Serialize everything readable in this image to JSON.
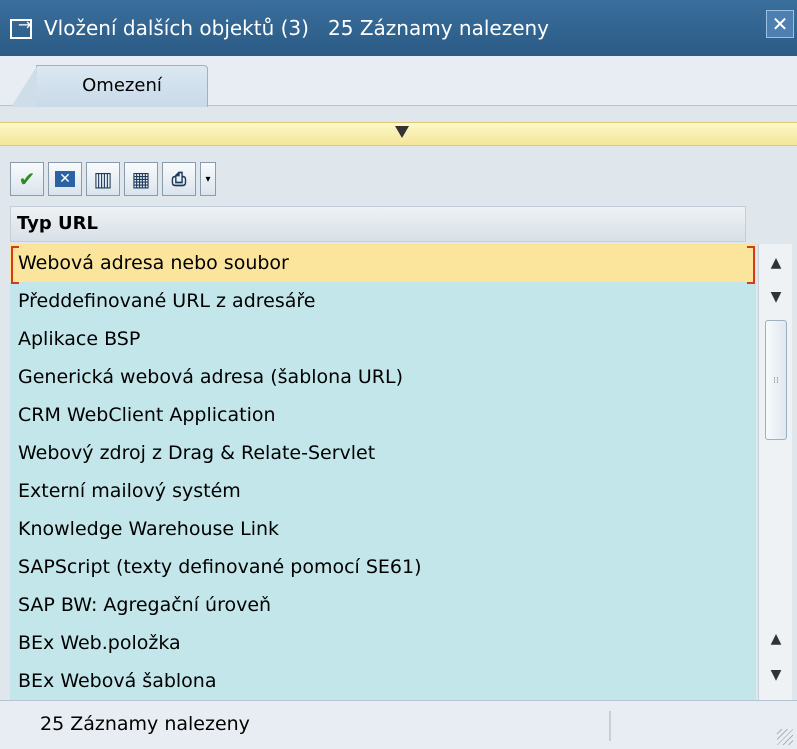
{
  "window": {
    "title": "Vložení dalších objektů (3)   25 Záznamy nalezeny",
    "close_glyph": "✕"
  },
  "tabs": [
    {
      "label": "Omezení"
    }
  ],
  "toolbar": {
    "buttons": [
      {
        "name": "confirm",
        "icon": "check-icon",
        "glyph": "✔"
      },
      {
        "name": "cancel",
        "icon": "cancel-icon",
        "glyph": "✕"
      },
      {
        "name": "find",
        "icon": "binoculars-icon",
        "glyph": "🔍"
      },
      {
        "name": "find-next",
        "icon": "binoculars-plus-icon",
        "glyph": "🔎"
      },
      {
        "name": "print",
        "icon": "printer-icon",
        "glyph": "⎙"
      }
    ],
    "dropdown_glyph": "▾"
  },
  "list": {
    "header": "Typ URL",
    "items": [
      "Webová adresa nebo soubor",
      "Předdefinované URL z adresáře",
      "Aplikace BSP",
      "Generická webová adresa (šablona URL)",
      "CRM WebClient Application",
      "Webový zdroj z Drag & Relate-Servlet",
      "Externí mailový systém",
      "Knowledge Warehouse Link",
      "SAPScript (texty definované pomocí SE61)",
      "SAP BW: Agregační úroveň",
      "BEx Web.položka",
      "BEx Webová šablona"
    ],
    "selected_index": 0
  },
  "status": {
    "text": "25 Záznamy nalezeny"
  },
  "colors": {
    "titlebar": "#2b5b86",
    "list_bg": "#c3e6ea",
    "selected_row": "#fbe59d"
  }
}
